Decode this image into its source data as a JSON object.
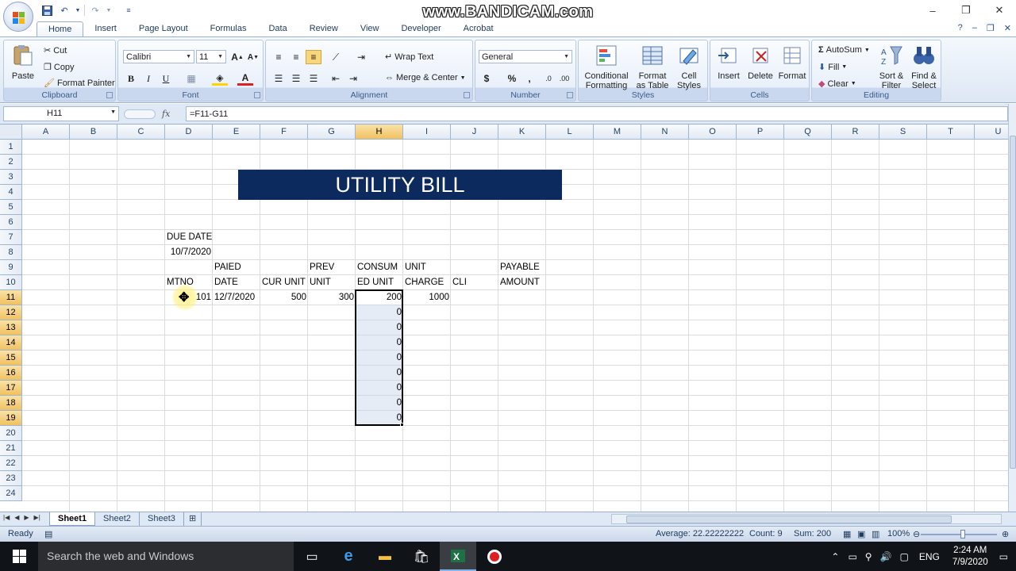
{
  "watermark": "www.BANDICAM.com",
  "quick_access": {
    "save_icon": "save-icon",
    "undo_icon": "undo-icon",
    "redo_icon": "redo-icon",
    "customize_icon": "customize-icon"
  },
  "window_controls": {
    "minimize": "–",
    "restore": "❐",
    "close": "✕"
  },
  "tabs": [
    "Home",
    "Insert",
    "Page Layout",
    "Formulas",
    "Data",
    "Review",
    "View",
    "Developer",
    "Acrobat"
  ],
  "active_tab": "Home",
  "ribbon": {
    "clipboard": {
      "label": "Clipboard",
      "paste": "Paste",
      "cut": "Cut",
      "copy": "Copy",
      "format_painter": "Format Painter"
    },
    "font": {
      "label": "Font",
      "font_name": "Calibri",
      "font_size": "11",
      "bold": "B",
      "italic": "I",
      "underline": "U"
    },
    "alignment": {
      "label": "Alignment",
      "wrap_text": "Wrap Text",
      "merge_center": "Merge & Center"
    },
    "number": {
      "label": "Number",
      "format": "General",
      "currency": "$",
      "percent": "%",
      "comma": ","
    },
    "styles": {
      "label": "Styles",
      "conditional_formatting": [
        "Conditional",
        "Formatting"
      ],
      "format_as_table": [
        "Format",
        "as Table"
      ],
      "cell_styles": [
        "Cell",
        "Styles"
      ]
    },
    "cells": {
      "label": "Cells",
      "insert": "Insert",
      "delete": "Delete",
      "format": "Format"
    },
    "editing": {
      "label": "Editing",
      "autosum": "AutoSum",
      "fill": "Fill",
      "clear": "Clear",
      "sort_filter": [
        "Sort &",
        "Filter"
      ],
      "find_select": [
        "Find &",
        "Select"
      ]
    }
  },
  "formula_bar": {
    "name_box": "H11",
    "fx": "fx",
    "formula": "=F11-G11"
  },
  "columns": [
    "A",
    "B",
    "C",
    "D",
    "E",
    "F",
    "G",
    "H",
    "I",
    "J",
    "K",
    "L",
    "M",
    "N",
    "O",
    "P",
    "Q",
    "R",
    "S",
    "T",
    "U"
  ],
  "rows": [
    "1",
    "2",
    "3",
    "4",
    "5",
    "6",
    "7",
    "8",
    "9",
    "10",
    "11",
    "12",
    "13",
    "14",
    "15",
    "16",
    "17",
    "18",
    "19",
    "20",
    "21",
    "22",
    "23",
    "24"
  ],
  "selected_column": "H",
  "selected_rows": [
    "11",
    "12",
    "13",
    "14",
    "15",
    "16",
    "17",
    "18",
    "19"
  ],
  "sheet": {
    "banner_title": "UTILITY BILL",
    "due_date_label": "DUE DATE",
    "due_date_value": "10/7/2020",
    "headers": {
      "mtno": "MTNO",
      "paied_date": [
        "PAIED",
        "DATE"
      ],
      "cur_unit": "CUR UNIT",
      "prev_unit": [
        "PREV",
        "UNIT"
      ],
      "consumed_unit": [
        "CONSUM",
        "ED UNIT"
      ],
      "unit_charge": [
        "UNIT",
        "CHARGE"
      ],
      "cli": "CLI",
      "payable_amount": [
        "PAYABLE",
        "AMOUNT"
      ]
    },
    "row11": {
      "mtno": "101",
      "paied_date": "12/7/2020",
      "cur_unit": "500",
      "prev_unit": "300",
      "consumed_unit": "200",
      "unit_charge": "1000"
    },
    "consumed_fill": [
      "0",
      "0",
      "0",
      "0",
      "0",
      "0",
      "0",
      "0"
    ]
  },
  "sheet_tabs": [
    "Sheet1",
    "Sheet2",
    "Sheet3"
  ],
  "active_sheet": "Sheet1",
  "status": {
    "mode": "Ready",
    "average": "Average: 22.22222222",
    "count": "Count: 9",
    "sum": "Sum: 200",
    "zoom": "100%"
  },
  "taskbar": {
    "search_placeholder": "Search the web and Windows",
    "language": "ENG",
    "time": "2:24 AM",
    "date": "7/9/2020"
  },
  "colors": {
    "banner": "#0d2a5e",
    "selection_header": "#f1c15f",
    "taskbar": "#101317"
  }
}
